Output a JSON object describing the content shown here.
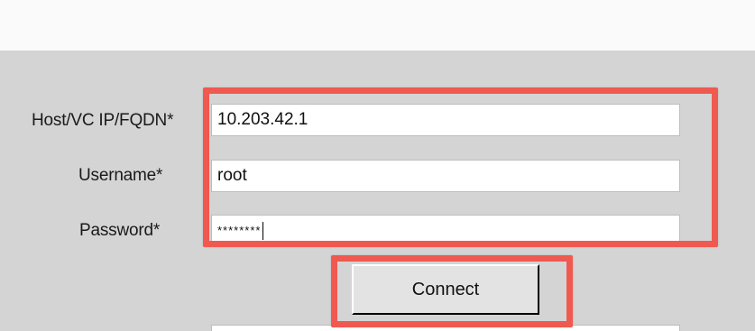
{
  "form": {
    "host_label": "Host/VC IP/FQDN*",
    "host_value": "10.203.42.1",
    "username_label": "Username*",
    "username_value": "root",
    "password_label": "Password*",
    "password_mask": "********"
  },
  "actions": {
    "connect_label": "Connect"
  },
  "colors": {
    "highlight": "#f0594f",
    "panel": "#d4d4d4"
  }
}
